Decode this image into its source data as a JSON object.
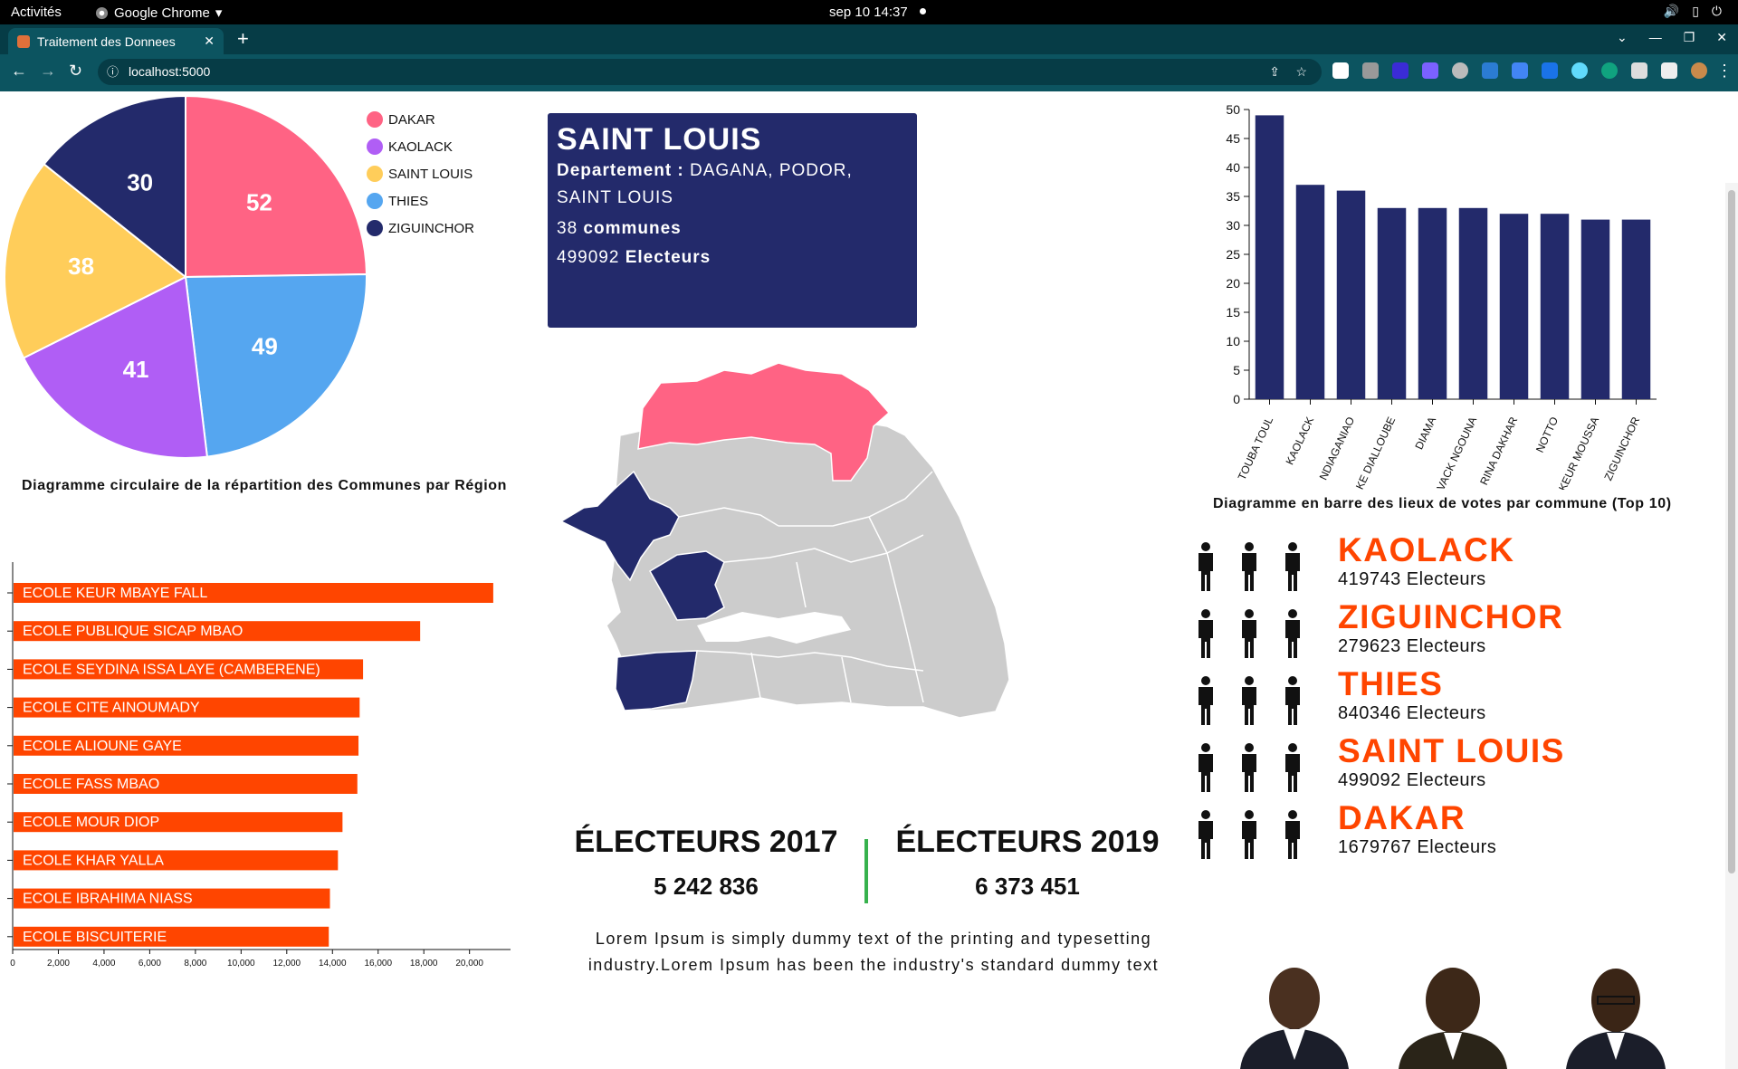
{
  "system": {
    "activities": "Activités",
    "app_name": "Google Chrome",
    "clock": "sep 10  14:37"
  },
  "browser": {
    "tab_title": "Traitement des Donnees",
    "url": "localhost:5000",
    "theme_color": "#0c5460"
  },
  "pie": {
    "caption": "Diagramme circulaire de la répartition des Communes par Région",
    "legend": [
      "DAKAR",
      "KAOLACK",
      "SAINT LOUIS",
      "THIES",
      "ZIGUINCHOR"
    ]
  },
  "chart_data": [
    {
      "type": "pie",
      "labels": [
        "DAKAR",
        "THIES",
        "KAOLACK",
        "SAINT LOUIS",
        "ZIGUINCHOR"
      ],
      "values": [
        52,
        49,
        41,
        38,
        30
      ],
      "colors": [
        "#ff6384",
        "#55a6f0",
        "#b05ef5",
        "#ffcd5a",
        "#232a6b"
      ],
      "legend_position": "right"
    },
    {
      "type": "bar",
      "title": "Diagramme en barre des lieux de votes par commune (Top 10)",
      "categories": [
        "TOUBA TOUL",
        "KAOLACK",
        "NDIAGANIAO",
        "KE DIALLOUBE",
        "DIAMA",
        "VACK NGOUNA",
        "RINA DAKHAR",
        "NOTTO",
        "KEUR MOUSSA",
        "ZIGUINCHOR"
      ],
      "values": [
        49,
        37,
        36,
        33,
        33,
        33,
        32,
        32,
        31,
        31
      ],
      "ylim": [
        0,
        50
      ],
      "yticks": [
        "0",
        "5",
        "10",
        "15",
        "20",
        "25",
        "30",
        "35",
        "40",
        "45",
        "50"
      ],
      "color": "#232a6b"
    },
    {
      "type": "bar",
      "orientation": "horizontal",
      "categories": [
        "ECOLE KEUR MBAYE FALL",
        "ECOLE PUBLIQUE SICAP MBAO",
        "ECOLE SEYDINA ISSA LAYE (CAMBERENE)",
        "ECOLE CITE AINOUMADY",
        "ECOLE ALIOUNE GAYE",
        "ECOLE FASS MBAO",
        "ECOLE MOUR DIOP",
        "ECOLE KHAR YALLA",
        "ECOLE IBRAHIMA NIASS",
        "ECOLE BISCUITERIE"
      ],
      "values": [
        21000,
        17800,
        15300,
        15150,
        15100,
        15050,
        14400,
        14200,
        13850,
        13800
      ],
      "xlim": [
        0,
        21000
      ],
      "xticks": [
        "0",
        "2,000",
        "4,000",
        "6,000",
        "8,000",
        "10,000",
        "12,000",
        "14,000",
        "16,000",
        "18,000",
        "20,000"
      ],
      "color": "#ff4500"
    }
  ],
  "card": {
    "region": "SAINT LOUIS",
    "dept_label": "Departement :",
    "dept_line1": "DAGANA, PODOR,",
    "dept_line2": "SAINT LOUIS",
    "communes_num": "38",
    "communes_label": "communes",
    "electeurs_num": "499092",
    "electeurs_label": "Electeurs"
  },
  "map": {
    "highlight": "#ff6384",
    "secondary": "#232a6b",
    "base": "#cccccc"
  },
  "elections": {
    "y2017_label": "ÉLECTEURS 2017",
    "y2017_value": "5 242 836",
    "y2019_label": "ÉLECTEURS 2019",
    "y2019_value": "6 373 451"
  },
  "lorem": "Lorem Ipsum is simply dummy text of the printing and typesetting industry.Lorem Ipsum has been the industry's standard dummy text",
  "regions": [
    {
      "name": "KAOLACK",
      "count": "419743 Electeurs"
    },
    {
      "name": "ZIGUINCHOR",
      "count": "279623 Electeurs"
    },
    {
      "name": "THIES",
      "count": "840346 Electeurs"
    },
    {
      "name": "SAINT LOUIS",
      "count": "499092 Electeurs"
    },
    {
      "name": "DAKAR",
      "count": "1679767 Electeurs"
    }
  ]
}
